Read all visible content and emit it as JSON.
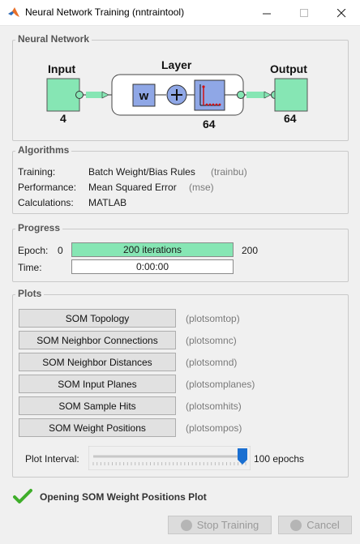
{
  "window": {
    "title": "Neural Network Training (nntraintool)"
  },
  "network": {
    "section_title": "Neural Network",
    "input_label": "Input",
    "input_size": "4",
    "layer_label": "Layer",
    "weight_symbol": "w",
    "layer_size": "64",
    "output_label": "Output",
    "output_size": "64"
  },
  "algorithms": {
    "section_title": "Algorithms",
    "rows": [
      {
        "label": "Training:",
        "value": "Batch Weight/Bias Rules",
        "fn": "(trainbu)"
      },
      {
        "label": "Performance:",
        "value": "Mean Squared Error",
        "fn": "(mse)"
      },
      {
        "label": "Calculations:",
        "value": "MATLAB",
        "fn": ""
      }
    ]
  },
  "progress": {
    "section_title": "Progress",
    "epoch_label": "Epoch:",
    "epoch_start": "0",
    "epoch_text": "200 iterations",
    "epoch_end": "200",
    "epoch_fraction": 1.0,
    "time_label": "Time:",
    "time_value": "0:00:00"
  },
  "plots": {
    "section_title": "Plots",
    "buttons": [
      {
        "label": "SOM Topology",
        "fn": "(plotsomtop)"
      },
      {
        "label": "SOM Neighbor Connections",
        "fn": "(plotsomnc)"
      },
      {
        "label": "SOM Neighbor Distances",
        "fn": "(plotsomnd)"
      },
      {
        "label": "SOM Input Planes",
        "fn": "(plotsomplanes)"
      },
      {
        "label": "SOM Sample Hits",
        "fn": "(plotsomhits)"
      },
      {
        "label": "SOM Weight Positions",
        "fn": "(plotsompos)"
      }
    ],
    "interval_label": "Plot Interval:",
    "interval_value_text": "100 epochs",
    "interval_fraction": 1.0
  },
  "status": {
    "message": "Opening SOM Weight Positions Plot"
  },
  "footer": {
    "stop_label": "Stop Training",
    "cancel_label": "Cancel"
  },
  "colors": {
    "block_green": "#86e6b4",
    "progress_green": "#86e6b4",
    "weight_blue": "#8fa7e6",
    "check_green": "#3fae2a",
    "slider_blue": "#1a6fd1"
  }
}
